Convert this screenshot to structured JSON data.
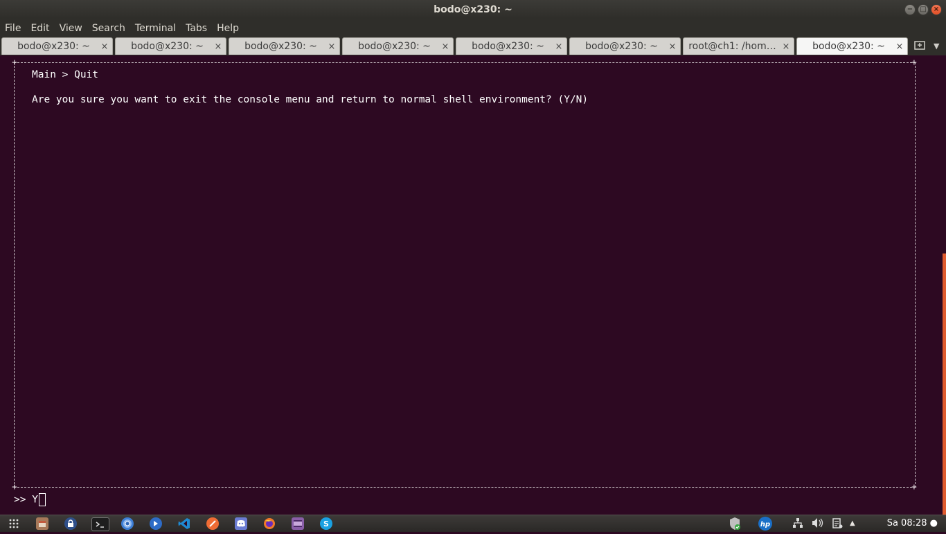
{
  "window": {
    "title": "bodo@x230: ~",
    "minimize_glyph": "−",
    "maximize_glyph": "□",
    "close_glyph": "×"
  },
  "menu": [
    "File",
    "Edit",
    "View",
    "Search",
    "Terminal",
    "Tabs",
    "Help"
  ],
  "tabs": [
    {
      "label": "bodo@x230: ~",
      "close": "×"
    },
    {
      "label": "bodo@x230: ~",
      "close": "×"
    },
    {
      "label": "bodo@x230: ~",
      "close": "×"
    },
    {
      "label": "bodo@x230: ~",
      "close": "×"
    },
    {
      "label": "bodo@x230: ~",
      "close": "×"
    },
    {
      "label": "bodo@x230: ~",
      "close": "×"
    },
    {
      "label": "root@ch1: /hom…",
      "close": "×"
    },
    {
      "label": "bodo@x230: ~",
      "close": "×"
    }
  ],
  "terminal": {
    "breadcrumb": "Main > Quit",
    "question": "Are you sure you want to exit the console menu and return to normal shell environment? (Y/N)",
    "prompt": ">> Y",
    "colors": {
      "background": "#2d0922",
      "text": "#ffffff"
    }
  },
  "panel": {
    "launchers": [
      {
        "name": "apps-grid-icon",
        "glyph": "⋮⋮⋮",
        "color": "#3a3734"
      },
      {
        "name": "files-icon",
        "glyph": "",
        "color": "#a7795a"
      },
      {
        "name": "lock-icon",
        "glyph": "",
        "color": "#3f6ab0"
      },
      {
        "name": "terminal-icon",
        "glyph": ">_",
        "color": "#2b2b2b"
      },
      {
        "name": "chromium-icon",
        "glyph": "",
        "color": "#3d7fd6"
      },
      {
        "name": "remmina-icon",
        "glyph": "",
        "color": "#2e6cc7"
      },
      {
        "name": "vscode-icon",
        "glyph": "",
        "color": "#1f8ad2"
      },
      {
        "name": "postman-icon",
        "glyph": "",
        "color": "#ef6c34"
      },
      {
        "name": "discord-icon",
        "glyph": "",
        "color": "#6b7cd3"
      },
      {
        "name": "firefox-icon",
        "glyph": "",
        "color": "#e8632b"
      },
      {
        "name": "video-editor-icon",
        "glyph": "",
        "color": "#8a5ea8"
      },
      {
        "name": "skype-icon",
        "glyph": "S",
        "color": "#1aa1e2"
      }
    ],
    "tray": {
      "security": "✔",
      "hp": "hp",
      "network": "⁂",
      "volume": "🔊",
      "clipboard": "▤",
      "chevron": "▲"
    },
    "clock": "Sa 08:28 ●"
  }
}
